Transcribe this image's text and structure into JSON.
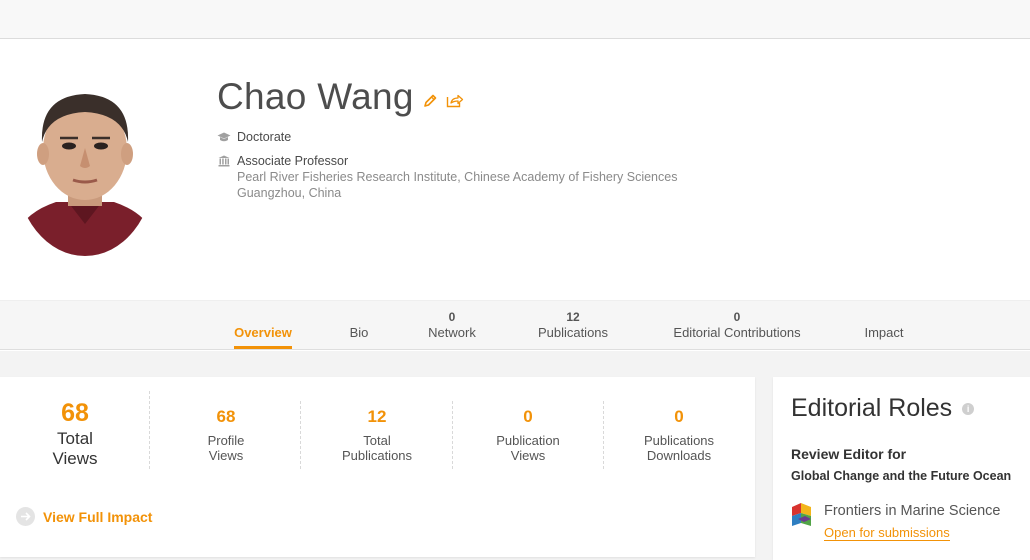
{
  "profile": {
    "name": "Chao Wang",
    "degree": "Doctorate",
    "position": "Associate Professor",
    "institution": "Pearl River Fisheries Research Institute, Chinese Academy of Fishery Sciences",
    "location": "Guangzhou, China"
  },
  "tabs": [
    {
      "count": "",
      "label": "Overview",
      "active": true
    },
    {
      "count": "",
      "label": "Bio"
    },
    {
      "count": "0",
      "label": "Network"
    },
    {
      "count": "12",
      "label": "Publications"
    },
    {
      "count": "0",
      "label": "Editorial Contributions"
    },
    {
      "count": "",
      "label": "Impact"
    }
  ],
  "stats": {
    "total_views": {
      "value": "68",
      "label_line1": "Total",
      "label_line2": "Views"
    },
    "items": [
      {
        "value": "68",
        "line1": "Profile",
        "line2": "Views"
      },
      {
        "value": "12",
        "line1": "Total",
        "line2": "Publications"
      },
      {
        "value": "0",
        "line1": "Publication",
        "line2": "Views"
      },
      {
        "value": "0",
        "line1": "Publications",
        "line2": "Downloads"
      }
    ],
    "view_full_impact": "View Full Impact"
  },
  "editorial": {
    "title": "Editorial Roles",
    "role": "Review Editor for",
    "topic": "Global Change and the Future Ocean",
    "journal": "Frontiers in Marine Science",
    "submissions": "Open for submissions"
  },
  "colors": {
    "accent": "#f29208",
    "text_dark": "#4d4d4d",
    "text_muted": "#8a8a8a"
  },
  "icons": [
    "pencil-icon",
    "share-icon",
    "graduation-cap-icon",
    "institution-icon",
    "arrow-right-icon",
    "info-icon",
    "journal-logo"
  ]
}
